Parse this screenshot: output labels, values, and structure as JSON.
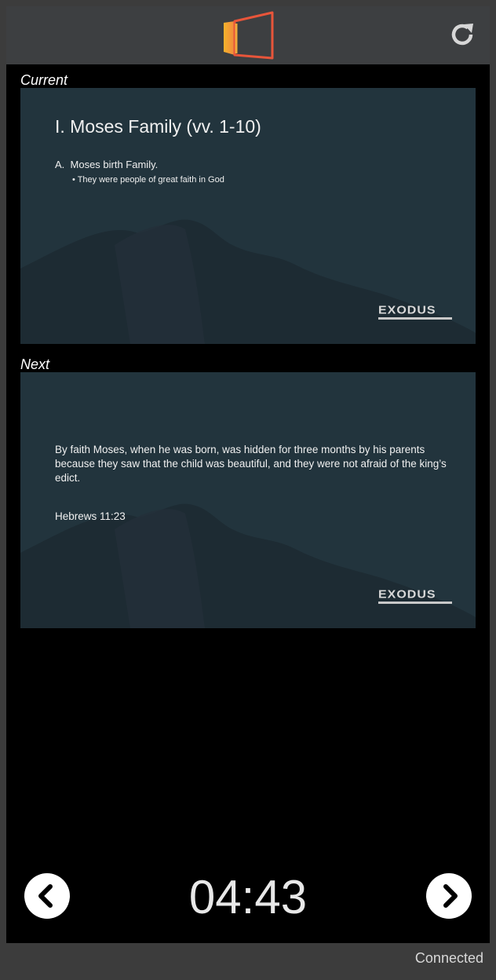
{
  "header": {
    "logo_icon": "presentation-logo-icon",
    "refresh_icon": "refresh-icon",
    "accent_colors": [
      "#f39c12",
      "#e74c3c"
    ]
  },
  "current": {
    "label": "Current",
    "slide": {
      "title": "I. Moses Family (vv. 1-10)",
      "item": "A.  Moses birth Family.",
      "bullet": "• They were people of great faith in God",
      "brand": "EXODUS"
    }
  },
  "next": {
    "label": "Next",
    "slide": {
      "quote": "By faith Moses, when he was born, was hidden for three months by his parents because they saw that the child was beautiful, and they were not afraid of the king’s edict.",
      "reference": "Hebrews 11:23",
      "brand": "EXODUS"
    }
  },
  "controls": {
    "prev_icon": "chevron-left-icon",
    "next_icon": "chevron-right-icon",
    "timer": "04:43"
  },
  "footer": {
    "status": "Connected"
  }
}
